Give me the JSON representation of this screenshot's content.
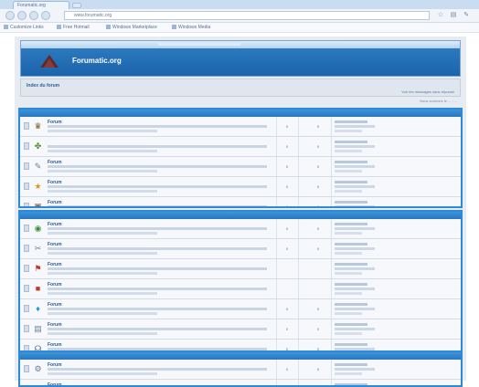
{
  "browser": {
    "tab_title": "Forumatic.org",
    "url": "www.forumatic.org",
    "bookmarks": [
      "Customize Links",
      "Free Hotmail",
      "Windows Marketplace",
      "Windows Media"
    ]
  },
  "site": {
    "title": "Forumatic.org",
    "breadcrumb": "Index du forum",
    "breadcrumb_right": "Voir les messages sans réponse",
    "subline": "Nous sommes le ... ; ...",
    "colors": {
      "accent": "#2c8ad9",
      "header": "#1c63ab",
      "background": "#e7ecf3"
    }
  },
  "categories": [
    {
      "forums": [
        {
          "name": "Forum",
          "icon": "trophy-icon",
          "icon_glyph": "♛",
          "icon_color": "#7a5a2a",
          "topics": "0",
          "posts": "0"
        },
        {
          "name": "",
          "icon": "puzzle-icon",
          "icon_glyph": "✤",
          "icon_color": "#4f8f2f",
          "topics": "0",
          "posts": "0"
        },
        {
          "name": "Forum",
          "icon": "page-icon",
          "icon_glyph": "✎",
          "icon_color": "#6c7f9a",
          "topics": "0",
          "posts": "0"
        },
        {
          "name": "Forum",
          "icon": "star-icon",
          "icon_glyph": "★",
          "icon_color": "#d49a1a",
          "topics": "0",
          "posts": "0"
        },
        {
          "name": "Forum",
          "icon": "image-icon",
          "icon_glyph": "▣",
          "icon_color": "#8a5a3a",
          "topics": "0",
          "posts": "0"
        }
      ]
    },
    {
      "forums": [
        {
          "name": "Forum",
          "icon": "globe-icon",
          "icon_glyph": "◉",
          "icon_color": "#3e8c3e",
          "topics": "0",
          "posts": "0"
        },
        {
          "name": "Forum",
          "icon": "tool-icon",
          "icon_glyph": "✂",
          "icon_color": "#6c7f9a",
          "topics": "0",
          "posts": "0"
        },
        {
          "name": "Forum",
          "icon": "flag-icon",
          "icon_glyph": "⚑",
          "icon_color": "#c0392b",
          "topics": "",
          "posts": ""
        },
        {
          "name": "Forum",
          "icon": "book-icon",
          "icon_glyph": "■",
          "icon_color": "#c0392b",
          "topics": "",
          "posts": ""
        },
        {
          "name": "Forum",
          "icon": "drop-icon",
          "icon_glyph": "♦",
          "icon_color": "#1a9ad6",
          "topics": "0",
          "posts": "0"
        },
        {
          "name": "Forum",
          "icon": "folder-icon",
          "icon_glyph": "▤",
          "icon_color": "#6c7f9a",
          "topics": "0",
          "posts": "0"
        },
        {
          "name": "Forum",
          "icon": "headphones-icon",
          "icon_glyph": "☊",
          "icon_color": "#556b8a",
          "topics": "0",
          "posts": "0"
        }
      ]
    },
    {
      "forums": [
        {
          "name": "Forum",
          "icon": "gear-icon",
          "icon_glyph": "⚙",
          "icon_color": "#6c7f9a",
          "topics": "0",
          "posts": "0"
        },
        {
          "name": "Forum",
          "icon": "folder-icon",
          "icon_glyph": "▤",
          "icon_color": "#6c7f9a",
          "topics": "",
          "posts": ""
        }
      ]
    }
  ]
}
